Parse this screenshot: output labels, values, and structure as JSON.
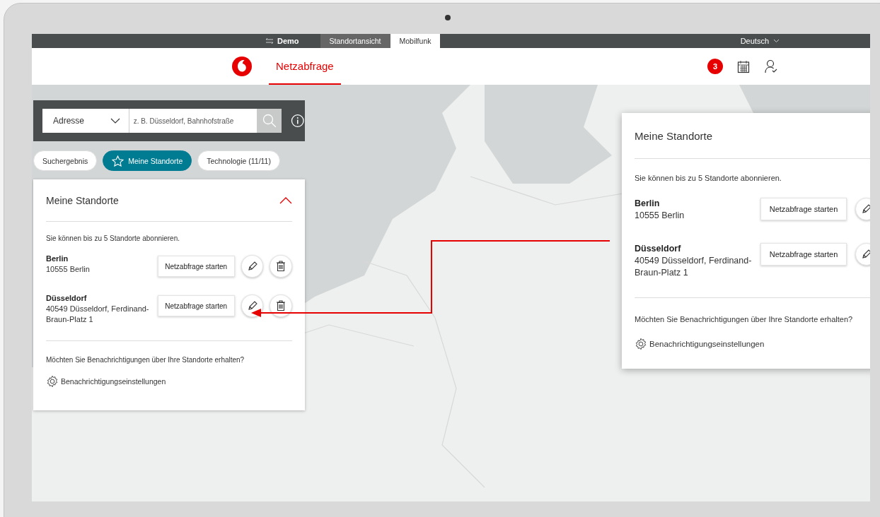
{
  "top_bar": {
    "mode_label": "Demo",
    "tabs": [
      {
        "label": "Standortansicht",
        "selected": false
      },
      {
        "label": "Mobilfunk",
        "selected": true
      }
    ],
    "language": "Deutsch"
  },
  "header": {
    "nav": [
      {
        "label": "Netzabfrage",
        "selected": true
      }
    ],
    "notification_count": "3"
  },
  "search": {
    "type_select": "Adresse",
    "placeholder": "z. B. Düsseldorf, Bahnhofstraße"
  },
  "filter_chips": [
    {
      "label": "Suchergebnis",
      "selected": false,
      "kind": "plain"
    },
    {
      "label": "Meine Standorte",
      "selected": true,
      "kind": "star"
    },
    {
      "label": "Technologie (11/11)",
      "selected": false,
      "kind": "plain"
    }
  ],
  "panel": {
    "title": "Meine Standorte",
    "expanded": true,
    "info": "Sie können bis zu 5 Standorte abonnieren.",
    "locations": [
      {
        "name": "Berlin",
        "address": "10555 Berlin",
        "action": "Netzabfrage starten"
      },
      {
        "name": "Düsseldorf",
        "address": "40549 Düsseldorf, Ferdinand-Braun-Platz 1",
        "action": "Netzabfrage starten"
      }
    ],
    "question": "Möchten Sie Benachrichtigungen über Ihre Standorte erhalten?",
    "settings_link": "Benachrichtigungseinstellungen"
  },
  "callout": {
    "title": "Meine Standorte",
    "info": "Sie können bis zu 5 Standorte abonnieren.",
    "locations": [
      {
        "name": "Berlin",
        "address": "10555 Berlin",
        "action": "Netzabfrage starten"
      },
      {
        "name": "Düsseldorf",
        "address": "40549 Düsseldorf, Ferdinand-Braun-Platz 1",
        "action": "Netzabfrage starten"
      }
    ],
    "question": "Möchten Sie Benachrichtigungen über Ihre Standorte erhalten?",
    "settings_link": "Benachrichtigungseinstellungen"
  }
}
